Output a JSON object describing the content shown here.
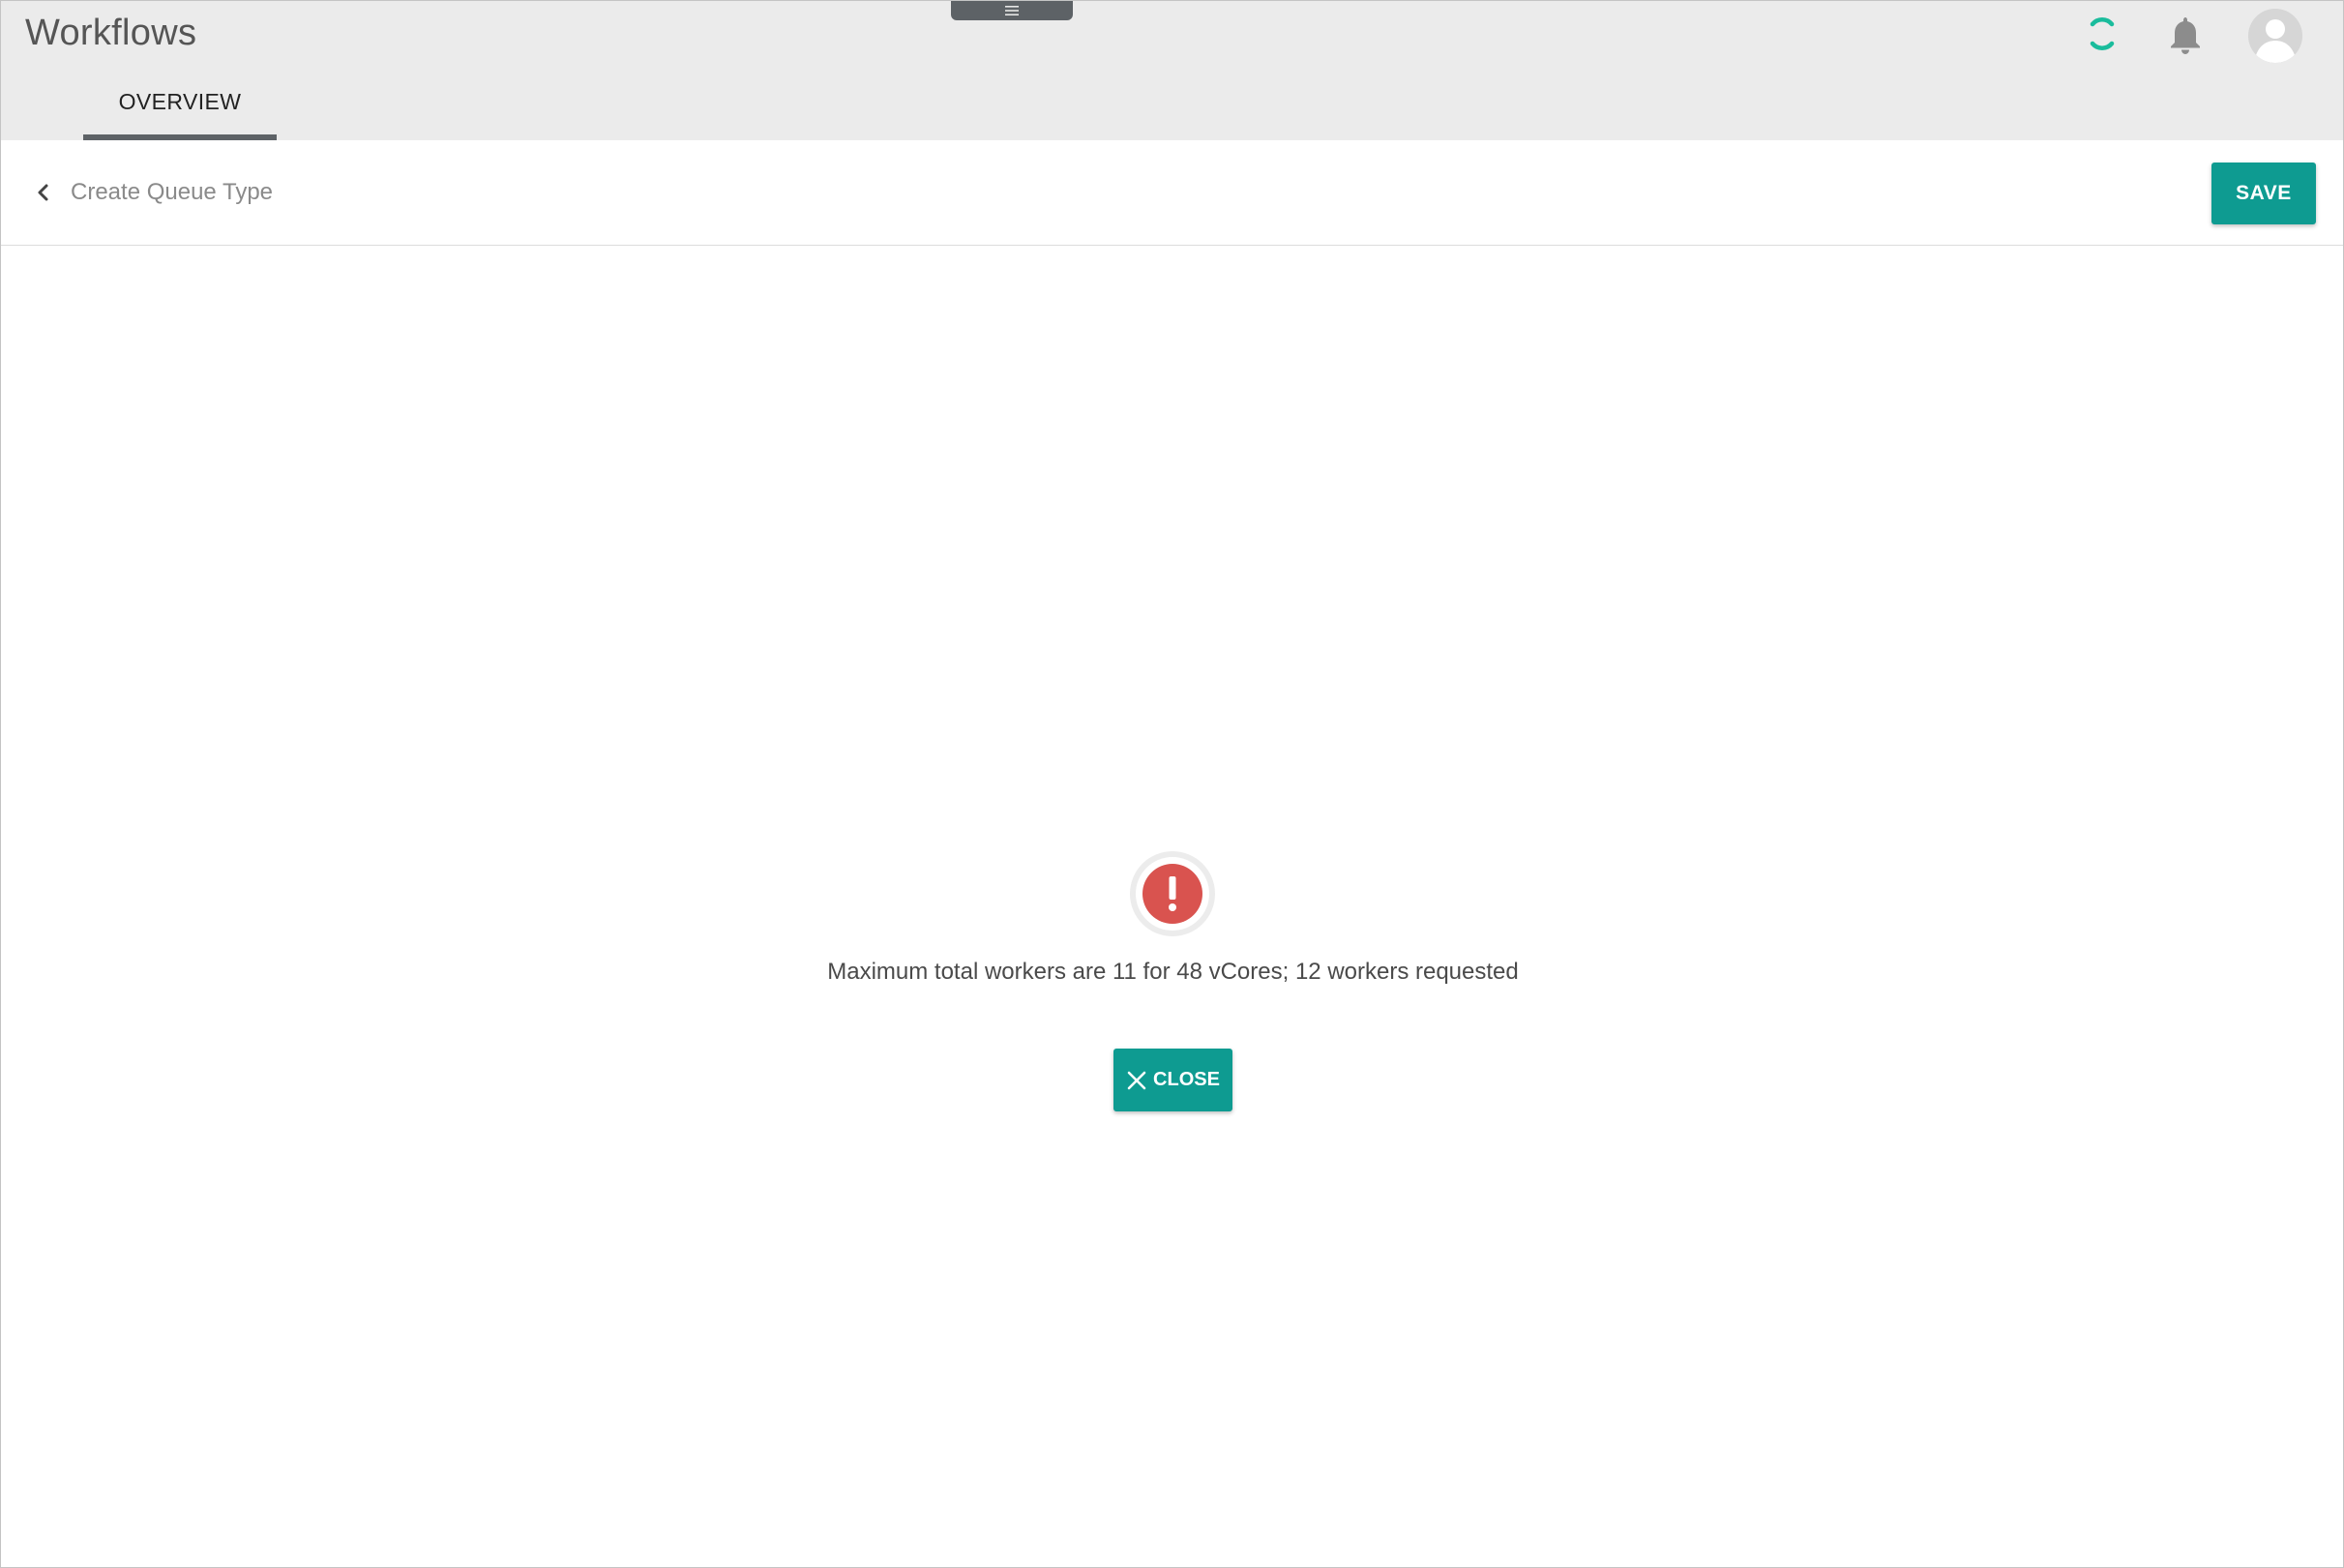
{
  "app": {
    "title": "Workflows"
  },
  "header": {
    "menu_icon": "menu-icon",
    "loading_icon": "loading-spinner-icon",
    "notifications_icon": "bell-icon",
    "user_icon": "avatar-icon"
  },
  "tabs": [
    {
      "label": "OVERVIEW",
      "active": true
    }
  ],
  "toolbar": {
    "back_icon": "chevron-left-icon",
    "breadcrumb": "Create Queue Type",
    "save_label": "SAVE"
  },
  "dialog": {
    "icon": "error-exclamation-icon",
    "message": "Maximum total workers are 11 for 48 vCores; 12 workers requested",
    "close_label": "CLOSE",
    "close_icon": "close-icon"
  },
  "colors": {
    "accent": "#0e9b91",
    "error": "#d9534f",
    "header_bg": "#ebebeb",
    "spinner": "#1abc9c"
  }
}
